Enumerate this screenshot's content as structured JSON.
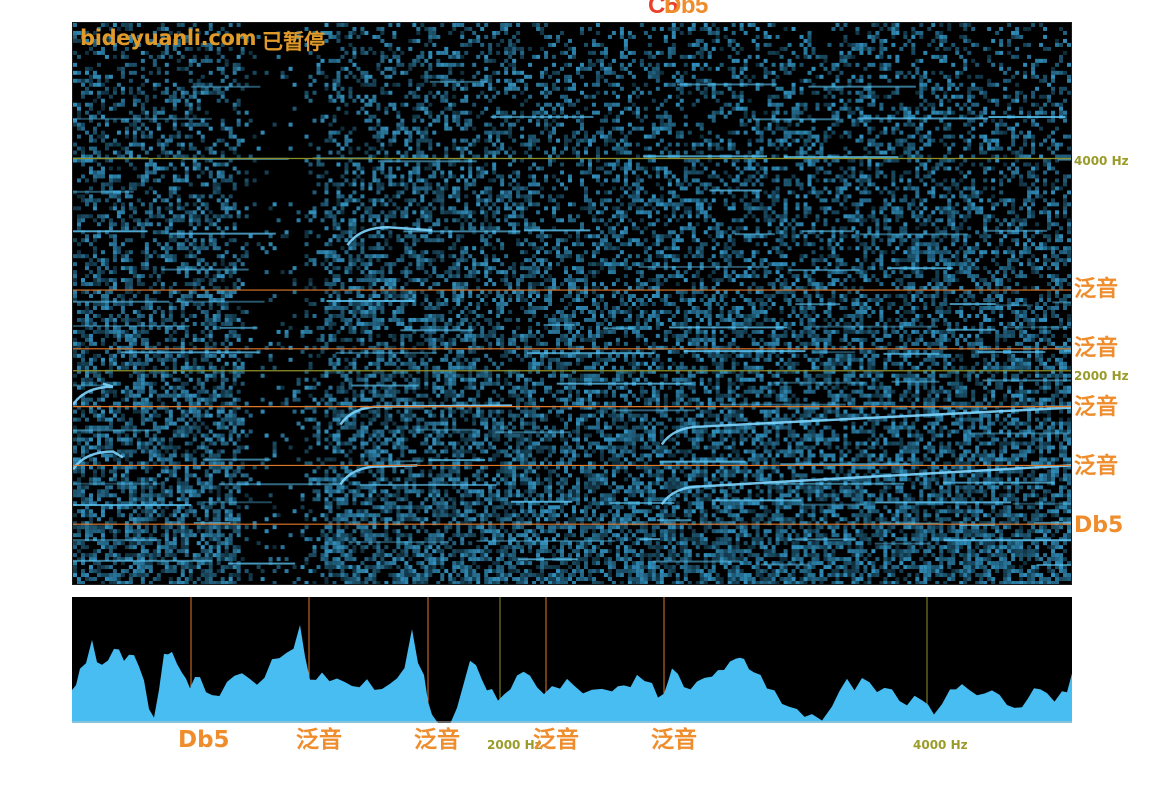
{
  "header": {
    "overlap_label_a": "C5",
    "overlap_label_b": "Db5"
  },
  "overlay": {
    "site": "bideyuanli.com",
    "status": "已暂停"
  },
  "spectrogram": {
    "right_labels": [
      {
        "text": "4000 Hz",
        "kind": "hz"
      },
      {
        "text": "泛音",
        "kind": "note"
      },
      {
        "text": "泛音",
        "kind": "note"
      },
      {
        "text": "2000 Hz",
        "kind": "hz"
      },
      {
        "text": "泛音",
        "kind": "note"
      },
      {
        "text": "泛音",
        "kind": "note"
      },
      {
        "text": "Db5",
        "kind": "note"
      }
    ]
  },
  "spectrum": {
    "bottom_labels": [
      {
        "text": "Db5",
        "kind": "note"
      },
      {
        "text": "泛音",
        "kind": "note"
      },
      {
        "text": "泛音",
        "kind": "note"
      },
      {
        "text": "2000 Hz",
        "kind": "hz"
      },
      {
        "text": "泛音",
        "kind": "note"
      },
      {
        "text": "泛音",
        "kind": "note"
      },
      {
        "text": "4000 Hz",
        "kind": "hz"
      }
    ]
  },
  "colors": {
    "note_line": "#e0782a",
    "hz_line": "#8f8f2a",
    "note_text": "#ef8c2c",
    "hz_text": "#9b9b2a",
    "watermark": "#e09a2a",
    "spectrum_fill": "#47bdf2",
    "spectrogram_base": "#000000",
    "spectrogram_signal": "#3aa9de",
    "top_label_red": "#e8402a",
    "top_label_orange": "#ef8c2c"
  }
}
